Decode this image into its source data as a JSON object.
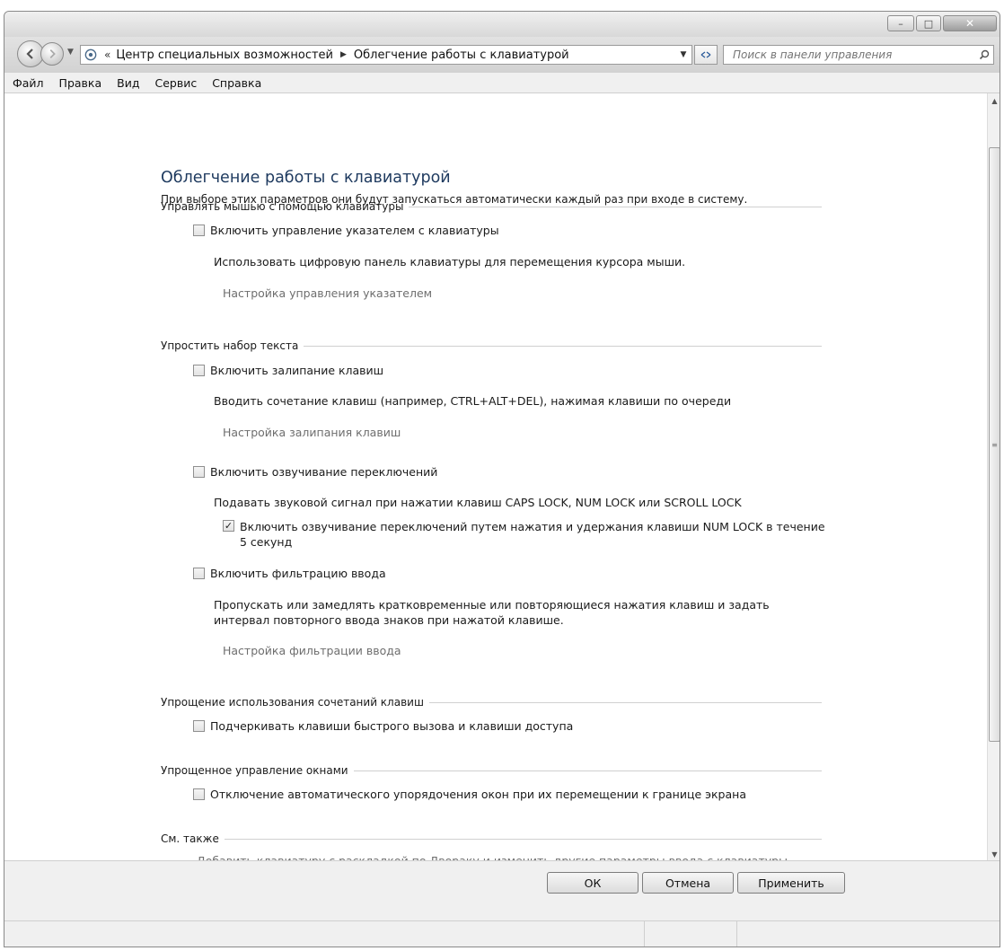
{
  "window": {
    "minimize_glyph": "–",
    "maximize_glyph": "□",
    "close_glyph": "✕"
  },
  "address": {
    "chevrons": "«",
    "crumbs": [
      "Центр специальных возможностей",
      "Облегчение работы с клавиатурой"
    ],
    "search_placeholder": "Поиск в панели управления"
  },
  "menu": [
    "Файл",
    "Правка",
    "Вид",
    "Сервис",
    "Справка"
  ],
  "page": {
    "title": "Облегчение работы с клавиатурой",
    "description": "При выборе этих параметров они будут запускаться автоматически каждый раз при входе в систему."
  },
  "sections": {
    "mouse": {
      "header": "Управлять мышью с помощью клавиатуры",
      "option": "Включить управление указателем с клавиатуры",
      "option_checked": false,
      "desc": "Использовать цифровую панель клавиатуры для перемещения курсора мыши.",
      "link": "Настройка управления указателем"
    },
    "typing": {
      "header": "Упростить набор текста",
      "sticky_option": "Включить залипание клавиш",
      "sticky_checked": false,
      "sticky_desc": "Вводить сочетание клавиш (например, CTRL+ALT+DEL), нажимая клавиши по очереди",
      "sticky_link": "Настройка залипания клавиш",
      "toggle_option": "Включить озвучивание переключений",
      "toggle_checked": false,
      "toggle_desc": "Подавать звуковой сигнал при нажатии клавиш CAPS LOCK, NUM LOCK или SCROLL LOCK",
      "toggle_sub_option": "Включить озвучивание переключений путем нажатия и удержания клавиши NUM LOCK в течение 5 секунд",
      "toggle_sub_checked": true,
      "filter_option": "Включить фильтрацию ввода",
      "filter_checked": false,
      "filter_desc": "Пропускать или замедлять кратковременные или повторяющиеся нажатия клавиш и задать интервал повторного ввода знаков при нажатой клавише.",
      "filter_link": "Настройка фильтрации ввода"
    },
    "shortcuts": {
      "header": "Упрощение использования сочетаний клавиш",
      "option": "Подчеркивать клавиши быстрого вызова и клавиши доступа",
      "option_checked": false
    },
    "windows": {
      "header": "Упрощенное управление окнами",
      "option": "Отключение автоматического упорядочения окон при их перемещении к границе экрана",
      "option_checked": false
    },
    "see_also": {
      "header": "См. также",
      "link": "Добавить клавиатуру с раскладкой по Двораку и изменить другие параметры ввода с клавиатуры"
    }
  },
  "buttons": {
    "ok": "ОК",
    "cancel": "Отмена",
    "apply": "Применить"
  },
  "checkmark_glyph": "✓"
}
